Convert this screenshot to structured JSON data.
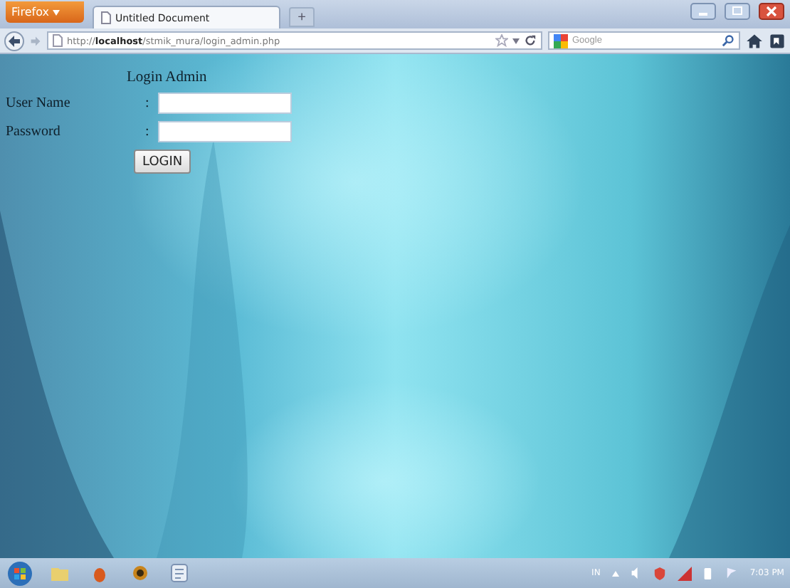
{
  "browser": {
    "menu_button": "Firefox",
    "tabs": [
      {
        "title": "Untitled Document",
        "selected": true
      }
    ],
    "new_tab": "+",
    "url": "http://**localhost**/stmik_mura/login_admin.php",
    "search_placeholder": "Google"
  },
  "page": {
    "heading": "Login Admin",
    "fields": [
      {
        "label": "User Name",
        "separator": ":"
      },
      {
        "label": "Password",
        "separator": ":"
      }
    ],
    "button": "LOGIN"
  },
  "taskbar": {
    "language": "IN",
    "clock": "7:03 PM"
  }
}
